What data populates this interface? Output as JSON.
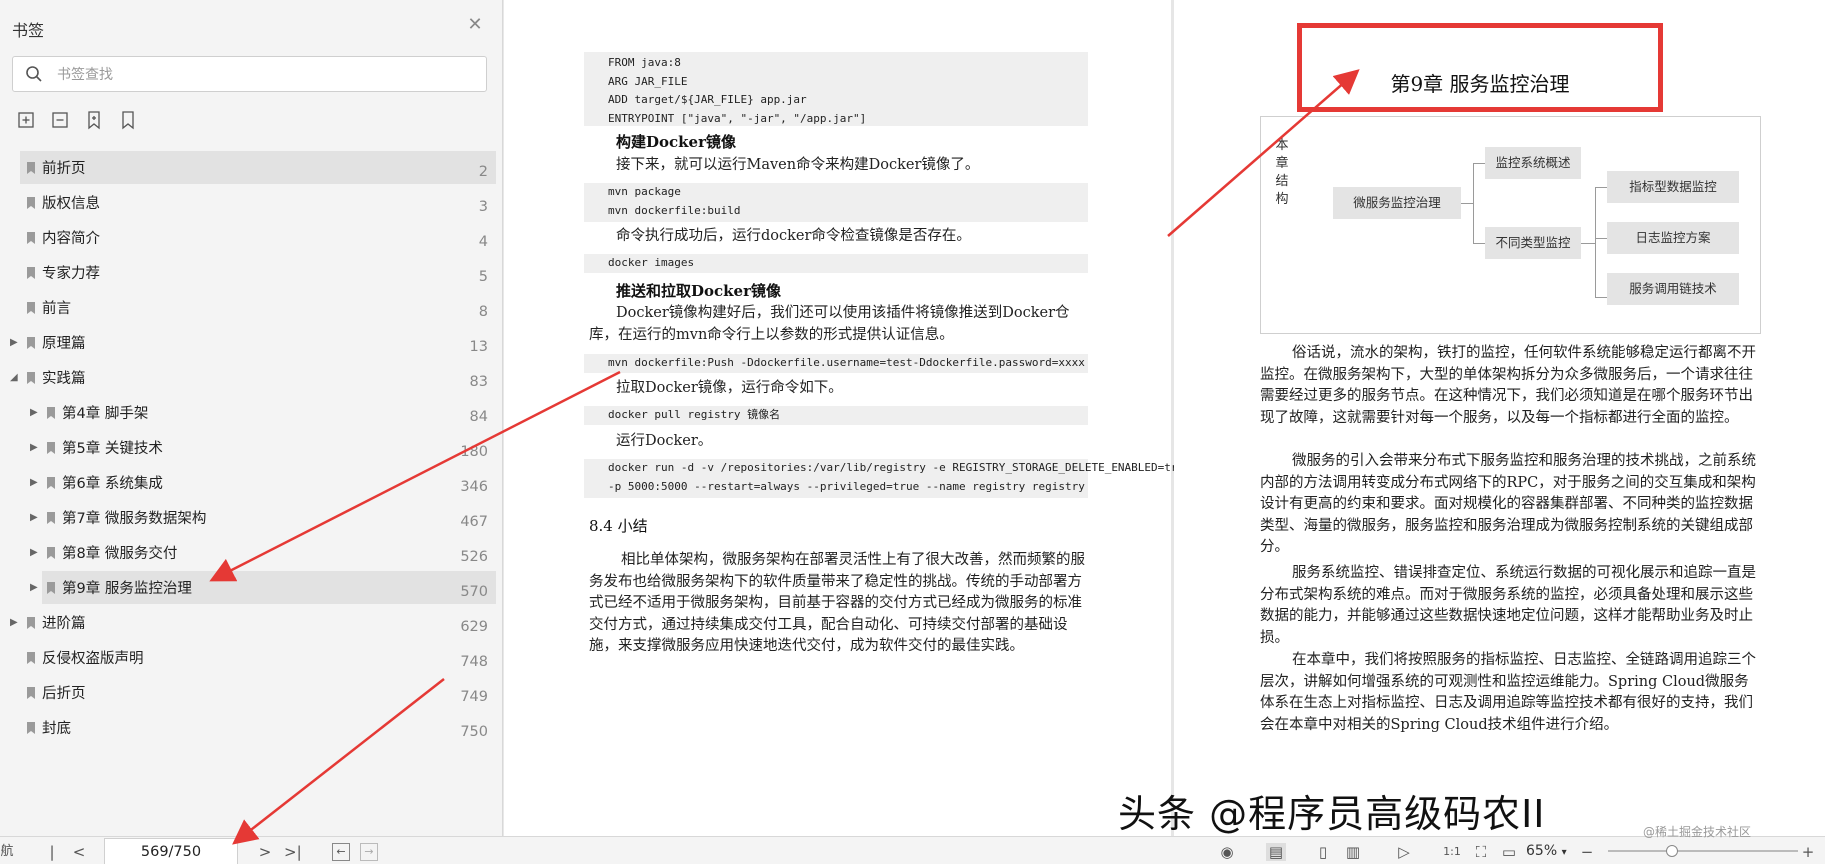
{
  "sidebar": {
    "title": "书签",
    "search_placeholder": "书签查找",
    "items": [
      {
        "label": "前折页",
        "page": "2",
        "level": 0,
        "expander": "",
        "selected": true
      },
      {
        "label": "版权信息",
        "page": "3",
        "level": 0,
        "expander": ""
      },
      {
        "label": "内容简介",
        "page": "4",
        "level": 0,
        "expander": ""
      },
      {
        "label": "专家力荐",
        "page": "5",
        "level": 0,
        "expander": ""
      },
      {
        "label": "前言",
        "page": "8",
        "level": 0,
        "expander": ""
      },
      {
        "label": "原理篇",
        "page": "13",
        "level": 0,
        "expander": "▶"
      },
      {
        "label": "实践篇",
        "page": "83",
        "level": 0,
        "expander": "◢"
      },
      {
        "label": "第4章 脚手架",
        "page": "84",
        "level": 1,
        "expander": "▶"
      },
      {
        "label": "第5章 关键技术",
        "page": "180",
        "level": 1,
        "expander": "▶"
      },
      {
        "label": "第6章 系统集成",
        "page": "346",
        "level": 1,
        "expander": "▶"
      },
      {
        "label": "第7章 微服务数据架构",
        "page": "467",
        "level": 1,
        "expander": "▶"
      },
      {
        "label": "第8章 微服务交付",
        "page": "526",
        "level": 1,
        "expander": "▶"
      },
      {
        "label": "第9章 服务监控治理",
        "page": "570",
        "level": 1,
        "expander": "▶",
        "selected": true
      },
      {
        "label": "进阶篇",
        "page": "629",
        "level": 0,
        "expander": "▶"
      },
      {
        "label": "反侵权盗版声明",
        "page": "748",
        "level": 0,
        "expander": ""
      },
      {
        "label": "后折页",
        "page": "749",
        "level": 0,
        "expander": ""
      },
      {
        "label": "封底",
        "page": "750",
        "level": 0,
        "expander": ""
      }
    ]
  },
  "left_page": {
    "code1": "FROM java:8\nARG JAR_FILE\nADD target/${JAR_FILE} app.jar\nENTRYPOINT [\"java\", \"-jar\", \"/app.jar\"]",
    "h_build": "构建Docker镜像",
    "p_build": "接下来，就可以运行Maven命令来构建Docker镜像了。",
    "code2": "mvn package\nmvn dockerfile:build",
    "p_check": "命令执行成功后，运行docker命令检查镜像是否存在。",
    "code3": "docker images",
    "h_push": "推送和拉取Docker镜像",
    "p_push": "Docker镜像构建好后，我们还可以使用该插件将镜像推送到Docker仓库，在运行的mvn命令行上以参数的形式提供认证信息。",
    "code4": "mvn dockerfile:Push -Ddockerfile.username=test-Ddockerfile.password=xxxx",
    "p_pull": "拉取Docker镜像，运行命令如下。",
    "code5": "docker pull registry 镜像名",
    "p_run": "运行Docker。",
    "code6": "docker run -d -v /repositories:/var/lib/registry -e REGISTRY_STORAGE_DELETE_ENABLED=true\n-p 5000:5000 --restart=always --privileged=true --name registry registry",
    "h_summary": "8.4 小结",
    "p_summary": "相比单体架构，微服务架构在部署灵活性上有了很大改善，然而频繁的服务发布也给微服务架构下的软件质量带来了稳定性的挑战。传统的手动部署方式已经不适用于微服务架构，目前基于容器的交付方式已经成为微服务的标准交付方式，通过持续集成交付工具，配合自动化、可持续交付部署的基础设施，来支撑微服务应用快速地迭代交付，成为软件交付的最佳实践。"
  },
  "right_page": {
    "chapter_title": "第9章 服务监控治理",
    "diagram": {
      "side_label": "本章结构",
      "root": "微服务监控治理",
      "level1": [
        "监控系统概述",
        "不同类型监控"
      ],
      "level2": [
        "指标型数据监控",
        "日志监控方案",
        "服务调用链技术"
      ]
    },
    "p1": "俗话说，流水的架构，铁打的监控，任何软件系统能够稳定运行都离不开监控。在微服务架构下，大型的单体架构拆分为众多微服务后，一个请求往往需要经过更多的服务节点。在这种情况下，我们必须知道是在哪个服务环节出现了故障，这就需要针对每一个服务，以及每一个指标都进行全面的监控。",
    "p2": "微服务的引入会带来分布式下服务监控和服务治理的技术挑战，之前系统内部的方法调用转变成分布式网络下的RPC，对于服务之间的交互集成和架构设计有更高的约束和要求。面对规模化的容器集群部署、不同种类的监控数据类型、海量的微服务，服务监控和服务治理成为微服务控制系统的关键组成部分。",
    "p3": "服务系统监控、错误排查定位、系统运行数据的可视化展示和追踪一直是分布式架构系统的难点。而对于微服务系统的监控，必须具备处理和展示这些数据的能力，并能够通过这些数据快速地定位问题，这样才能帮助业务及时止损。",
    "p4": "在本章中，我们将按照服务的指标监控、日志监控、全链路调用追踪三个层次，讲解如何增强系统的可观测性和监控运维能力。Spring Cloud微服务体系在生态上对指标监控、日志及调用追踪等监控技术都有很好的支持，我们会在本章中对相关的Spring Cloud技术组件进行介绍。"
  },
  "watermark": "头条 @程序员高级码农II",
  "watermark_sub": "@稀土掘金技术社区",
  "statusbar": {
    "left_stub": "航",
    "page_value": "569/750",
    "zoom": "65%",
    "plus": "+"
  },
  "colors": {
    "annotation": "#e53935",
    "selected_row": "#e2e2e2"
  }
}
